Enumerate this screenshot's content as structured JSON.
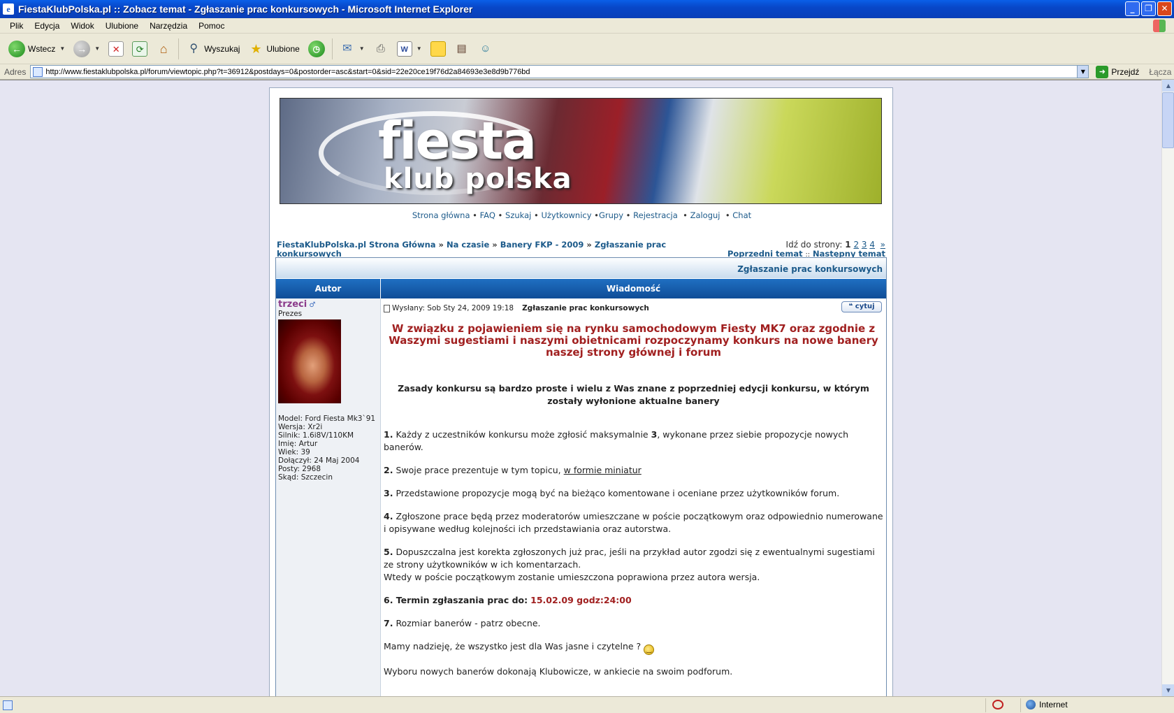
{
  "window": {
    "title": "FiestaKlubPolska.pl :: Zobacz temat - Zgłaszanie prac konkursowych - Microsoft Internet Explorer"
  },
  "menu": [
    "Plik",
    "Edycja",
    "Widok",
    "Ulubione",
    "Narzędzia",
    "Pomoc"
  ],
  "toolbar": {
    "back_label": "Wstecz",
    "search_label": "Wyszukaj",
    "favorites_label": "Ulubione"
  },
  "address": {
    "label": "Adres",
    "url": "http://www.fiestaklubpolska.pl/forum/viewtopic.php?t=36912&postdays=0&postorder=asc&start=0&sid=22e20ce19f76d2a84693e3e8d9b776bd",
    "go_label": "Przejdź",
    "links_label": "Łącza"
  },
  "banner": {
    "logo_line1": "fiesta",
    "logo_line2": "klub polska"
  },
  "nav": {
    "home": "Strona główna",
    "faq": "FAQ",
    "search": "Szukaj",
    "users": "Użytkownicy",
    "groups": "Grupy",
    "register": "Rejestracja",
    "login": "Zaloguj",
    "chat": "Chat"
  },
  "breadcrumb": {
    "root": "FiestaKlubPolska.pl Strona Główna",
    "cat1": "Na czasie",
    "cat2": "Banery FKP - 2009",
    "topic": "Zgłaszanie prac konkursowych"
  },
  "pager": {
    "label": "Idź do strony:",
    "current": "1",
    "pages": [
      "2",
      "3",
      "4"
    ],
    "next": "»",
    "prev_topic": "Poprzedni temat",
    "sep": "::",
    "next_topic": "Następny temat"
  },
  "topic_title": "Zgłaszanie prac konkursowych",
  "table_headers": {
    "author": "Autor",
    "message": "Wiadomość"
  },
  "author": {
    "name": "trzeci",
    "rank": "Prezes",
    "details": [
      "Model: Ford Fiesta Mk3`91",
      "Wersja: Xr2i",
      "Silnik: 1.6i8V/110KM",
      "Imię: Artur",
      "Wiek: 39",
      "Dołączył: 24 Maj 2004",
      "Posty: 2968",
      "Skąd: Szczecin"
    ]
  },
  "post": {
    "posted": "Wysłany: Sob Sty 24, 2009 19:18",
    "subject": "Zgłaszanie prac konkursowych",
    "quote_label": "cytuj",
    "red_heading": "W związku z pojawieniem się na rynku samochodowym Fiesty MK7 oraz zgodnie z Waszymi sugestiami i naszymi obietnicami rozpoczynamy konkurs na nowe banery naszej strony głównej i forum",
    "black_heading": "Zasady konkursu są bardzo proste i wielu z Was znane z poprzedniej edycji konkursu, w którym zostały wyłonione aktualne banery",
    "r1_num": "1.",
    "r1_a": "Każdy z uczestników konkursu może zgłosić maksymalnie",
    "r1_bold": "3",
    "r1_b": ", wykonane przez siebie propozycje nowych banerów.",
    "r2_num": "2.",
    "r2_a": "Swoje prace prezentuje w tym topicu,",
    "r2_u": "w formie miniatur",
    "r3_num": "3.",
    "r3": "Przedstawione propozycje mogą być na bieżąco komentowane i oceniane przez użytkowników forum.",
    "r4_num": "4.",
    "r4": "Zgłoszone prace będą przez moderatorów umieszczane w poście początkowym oraz odpowiednio numerowane i opisywane według kolejności ich przedstawiania oraz autorstwa.",
    "r5_num": "5.",
    "r5_a": "Dopuszczalna jest korekta zgłoszonych już prac, jeśli na przykład autor zgodzi się z ewentualnymi sugestiami ze strony użytkowników w ich komentarzach.",
    "r5_b": "Wtedy w poście początkowym zostanie umieszczona poprawiona przez autora wersja.",
    "r6_label": "6. Termin zgłaszania prac do:",
    "r6_date": "15.02.09 godz:24:00",
    "r7_num": "7.",
    "r7": "Rozmiar banerów - patrz obecne.",
    "closing": "Mamy nadzieję, że wszystko jest dla Was jasne i czytelne ?",
    "last": "Wyboru nowych banerów dokonają Klubowicze, w ankiecie na swoim podforum."
  },
  "status": {
    "zone": "Internet"
  }
}
